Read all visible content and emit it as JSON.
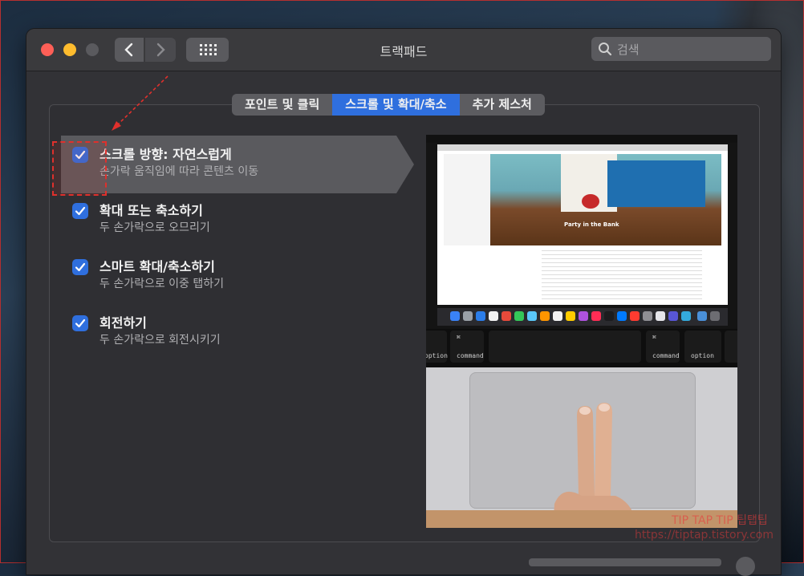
{
  "window": {
    "title": "트랙패드",
    "search_placeholder": "검색"
  },
  "tabs": [
    {
      "label": "포인트 및 클릭",
      "active": false
    },
    {
      "label": "스크롤 및 확대/축소",
      "active": true
    },
    {
      "label": "추가 제스처",
      "active": false
    }
  ],
  "options": [
    {
      "title": "스크롤 방향: 자연스럽게",
      "subtitle": "손가락 움직임에 따라 콘텐츠 이동",
      "checked": true,
      "selected": true
    },
    {
      "title": "확대 또는 축소하기",
      "subtitle": "두 손가락으로 오므리기",
      "checked": true,
      "selected": false
    },
    {
      "title": "스마트 확대/축소하기",
      "subtitle": "두 손가락으로 이중 탭하기",
      "checked": true,
      "selected": false
    },
    {
      "title": "회전하기",
      "subtitle": "두 손가락으로 회전시키기",
      "checked": true,
      "selected": false
    }
  ],
  "preview": {
    "hero_caption": "Party in the Bank",
    "keys": {
      "left_option": "option",
      "left_command": "command",
      "left_command_symbol": "⌘",
      "right_command": "command",
      "right_command_symbol": "⌘",
      "right_option": "option"
    }
  },
  "watermark": {
    "line1": "TIP TAP TIP 팁탭팁",
    "line2": "https://tiptap.tistory.com"
  },
  "colors": {
    "accent": "#2f6fde",
    "annotation": "#e0302c"
  }
}
